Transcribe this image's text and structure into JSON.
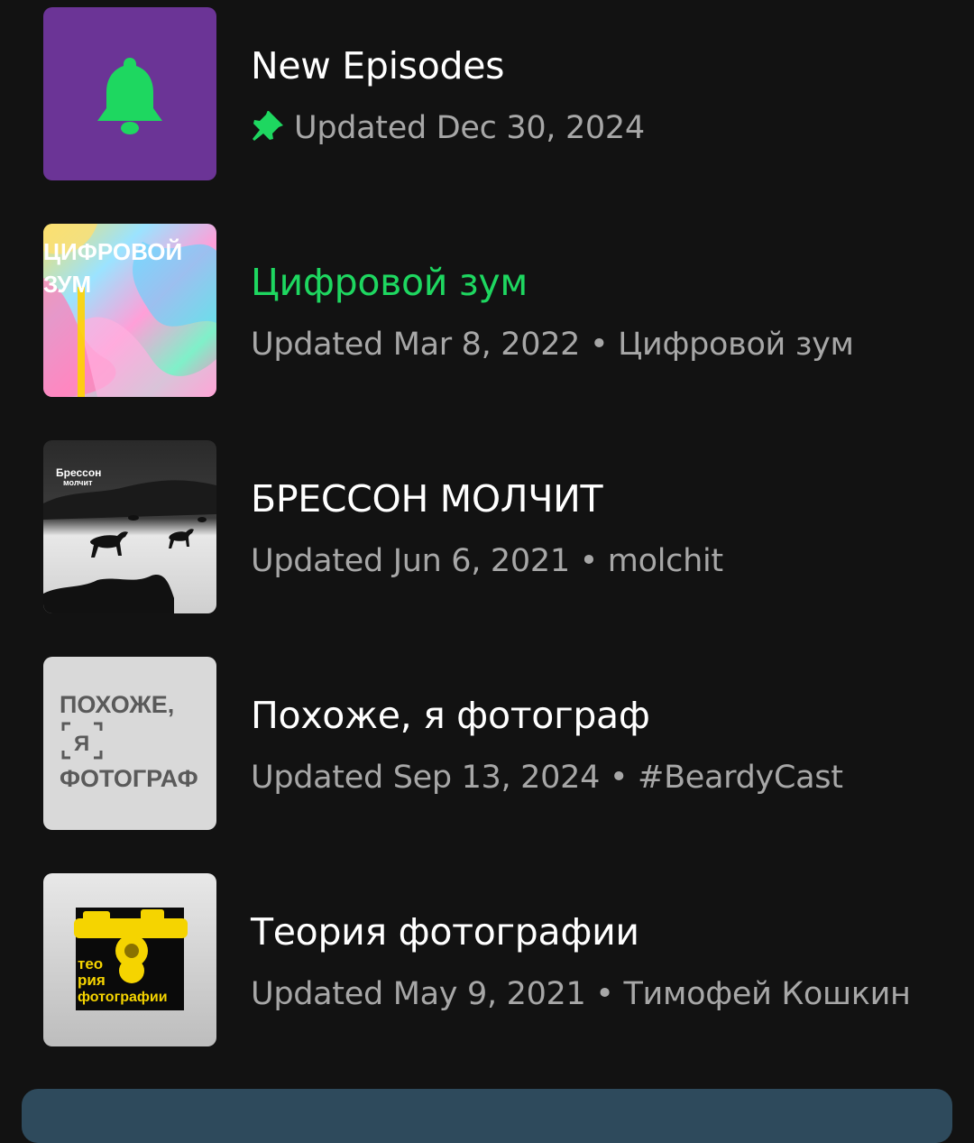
{
  "items": [
    {
      "title": "New Episodes",
      "subtitle": "Updated Dec 30, 2024",
      "pinned": true,
      "icon": "bell-icon",
      "thumb_color": "#6b3496",
      "accent": "#1ed760"
    },
    {
      "title": "Цифровой зум",
      "subtitle": "Updated Mar 8, 2022 • Цифровой зум",
      "active": true,
      "cover_text": [
        "ЦИФРОВОЙ",
        "ЗУМ"
      ]
    },
    {
      "title": "БРЕССОН МОЛЧИТ",
      "subtitle": "Updated Jun 6, 2021 • molchit",
      "cover_text": [
        "Брессон",
        "молчит"
      ]
    },
    {
      "title": "Похоже, я фотограф",
      "subtitle": "Updated Sep 13, 2024 • #BeardyCast",
      "cover_text": [
        "ПОХОЖЕ,",
        "Я",
        "ФОТОГРАФ"
      ]
    },
    {
      "title": "Теория фотографии",
      "subtitle": "Updated May 9, 2021 • Тимофей Кошкин",
      "cover_text": [
        "тео",
        "рия",
        "фотографии"
      ]
    }
  ],
  "colors": {
    "background": "#121212",
    "text_primary": "#ffffff",
    "text_secondary": "#a7a7a7",
    "accent_green": "#1ed760",
    "bottom_bar": "#2e4a5c"
  }
}
